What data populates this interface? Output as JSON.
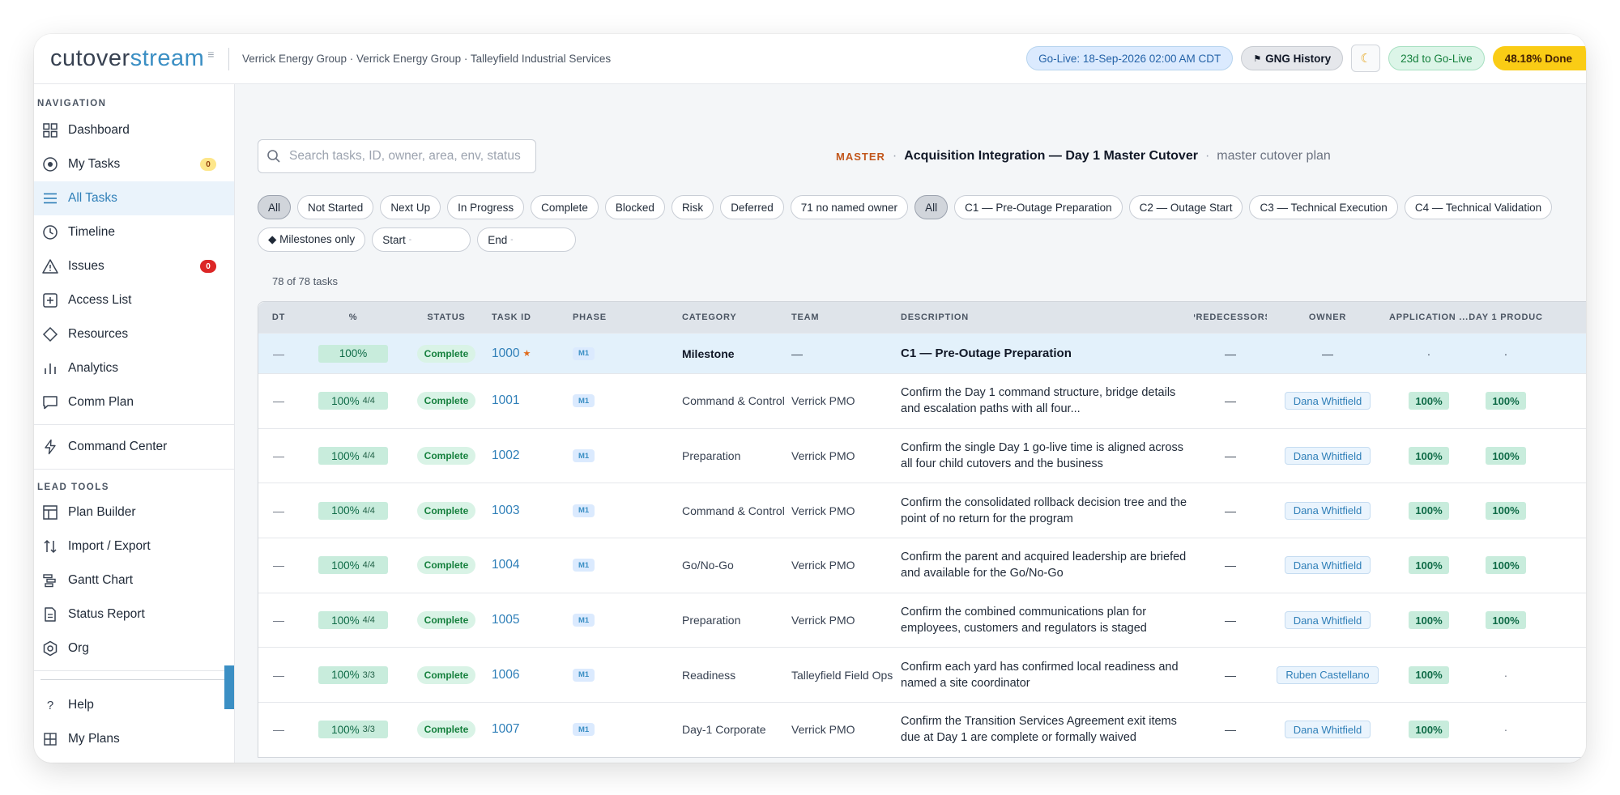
{
  "app": {
    "logo_part1": "cutover",
    "logo_part2": "stream",
    "breadcrumb": "Verrick Energy Group · Verrick Energy Group · Talleyfield Industrial Services"
  },
  "header": {
    "golive": "Go-Live: 18-Sep-2026 02:00 AM CDT",
    "gng_history": "GNG History",
    "days_to_golive": "23d to Go-Live",
    "done": "48.18% Done"
  },
  "sidebar": {
    "nav_title": "NAVIGATION",
    "nav": [
      {
        "label": "Dashboard",
        "icon": "dashboard-icon"
      },
      {
        "label": "My Tasks",
        "icon": "target-icon",
        "badge": "0"
      },
      {
        "label": "All Tasks",
        "icon": "list-icon",
        "active": true
      },
      {
        "label": "Timeline",
        "icon": "clock-icon"
      },
      {
        "label": "Issues",
        "icon": "warning-icon",
        "badge": "0"
      },
      {
        "label": "Access List",
        "icon": "plus-square-icon"
      },
      {
        "label": "Resources",
        "icon": "diamond-icon"
      },
      {
        "label": "Analytics",
        "icon": "bar-chart-icon"
      },
      {
        "label": "Comm Plan",
        "icon": "message-icon"
      },
      {
        "label": "Command Center",
        "icon": "lightning-icon"
      }
    ],
    "lead_title": "LEAD TOOLS",
    "lead": [
      {
        "label": "Plan Builder",
        "icon": "layout-icon"
      },
      {
        "label": "Import / Export",
        "icon": "arrows-icon"
      },
      {
        "label": "Gantt Chart",
        "icon": "gantt-icon"
      },
      {
        "label": "Status Report",
        "icon": "document-icon"
      },
      {
        "label": "Org",
        "icon": "hexagon-icon"
      }
    ],
    "bottom": [
      {
        "label": "Help",
        "icon": "question-icon"
      },
      {
        "label": "My Plans",
        "icon": "grid-icon"
      }
    ]
  },
  "main": {
    "search_placeholder": "Search tasks, ID, owner, area, env, status",
    "plan_badge": "MASTER",
    "plan_name": "Acquisition Integration — Day 1 Master Cutover",
    "plan_sub": "master cutover plan",
    "status_filters": [
      "All",
      "Not Started",
      "Next Up",
      "In Progress",
      "Complete",
      "Blocked",
      "Risk",
      "Deferred",
      "71 no named owner"
    ],
    "phase_filters": [
      "All",
      "C1 — Pre-Outage Preparation",
      "C2 — Outage Start",
      "C3 — Technical Execution",
      "C4 — Technical Validation"
    ],
    "milestones_only": "◆ Milestones only",
    "start_label": "Start",
    "end_label": "End",
    "date_placeholder": "-",
    "count": "78 of 78 tasks"
  },
  "table": {
    "columns": [
      "DT",
      "%",
      "STATUS",
      "TASK ID",
      "PHASE",
      "CATEGORY",
      "TEAM",
      "DESCRIPTION",
      "PREDECESSORS",
      "OWNER",
      "APPLICATION ...",
      "DAY 1 PRODUC"
    ],
    "milestone": {
      "dt": "—",
      "pct": "100%",
      "status": "Complete",
      "id": "1000",
      "phase": "M1",
      "category": "Milestone",
      "team": "—",
      "desc": "C1 — Pre-Outage Preparation",
      "pred": "—",
      "owner": "—",
      "app": "·",
      "d1": "·"
    },
    "rows": [
      {
        "dt": "—",
        "pct": "100%",
        "frac": "4/4",
        "status": "Complete",
        "id": "1001",
        "phase": "M1",
        "category": "Command & Control",
        "team": "Verrick PMO",
        "desc": "Confirm the Day 1 command structure, bridge details and escalation paths with all four...",
        "pred": "—",
        "owner": "Dana Whitfield",
        "app": "100%",
        "d1": "100%"
      },
      {
        "dt": "—",
        "pct": "100%",
        "frac": "4/4",
        "status": "Complete",
        "id": "1002",
        "phase": "M1",
        "category": "Preparation",
        "team": "Verrick PMO",
        "desc": "Confirm the single Day 1 go-live time is aligned across all four child cutovers and the business",
        "pred": "—",
        "owner": "Dana Whitfield",
        "app": "100%",
        "d1": "100%"
      },
      {
        "dt": "—",
        "pct": "100%",
        "frac": "4/4",
        "status": "Complete",
        "id": "1003",
        "phase": "M1",
        "category": "Command & Control",
        "team": "Verrick PMO",
        "desc": "Confirm the consolidated rollback decision tree and the point of no return for the program",
        "pred": "—",
        "owner": "Dana Whitfield",
        "app": "100%",
        "d1": "100%"
      },
      {
        "dt": "—",
        "pct": "100%",
        "frac": "4/4",
        "status": "Complete",
        "id": "1004",
        "phase": "M1",
        "category": "Go/No-Go",
        "team": "Verrick PMO",
        "desc": "Confirm the parent and acquired leadership are briefed and available for the Go/No-Go",
        "pred": "—",
        "owner": "Dana Whitfield",
        "app": "100%",
        "d1": "100%"
      },
      {
        "dt": "—",
        "pct": "100%",
        "frac": "4/4",
        "status": "Complete",
        "id": "1005",
        "phase": "M1",
        "category": "Preparation",
        "team": "Verrick PMO",
        "desc": "Confirm the combined communications plan for employees, customers and regulators is staged",
        "pred": "—",
        "owner": "Dana Whitfield",
        "app": "100%",
        "d1": "100%"
      },
      {
        "dt": "—",
        "pct": "100%",
        "frac": "3/3",
        "status": "Complete",
        "id": "1006",
        "phase": "M1",
        "category": "Readiness",
        "team": "Talleyfield Field Ops",
        "desc": "Confirm each yard has confirmed local readiness and named a site coordinator",
        "pred": "—",
        "owner": "Ruben Castellano",
        "app": "100%",
        "d1": "·"
      },
      {
        "dt": "—",
        "pct": "100%",
        "frac": "3/3",
        "status": "Complete",
        "id": "1007",
        "phase": "M1",
        "category": "Day-1 Corporate",
        "team": "Verrick PMO",
        "desc": "Confirm the Transition Services Agreement exit items due at Day 1 are complete or formally waived",
        "pred": "—",
        "owner": "Dana Whitfield",
        "app": "100%",
        "d1": "·"
      }
    ]
  }
}
